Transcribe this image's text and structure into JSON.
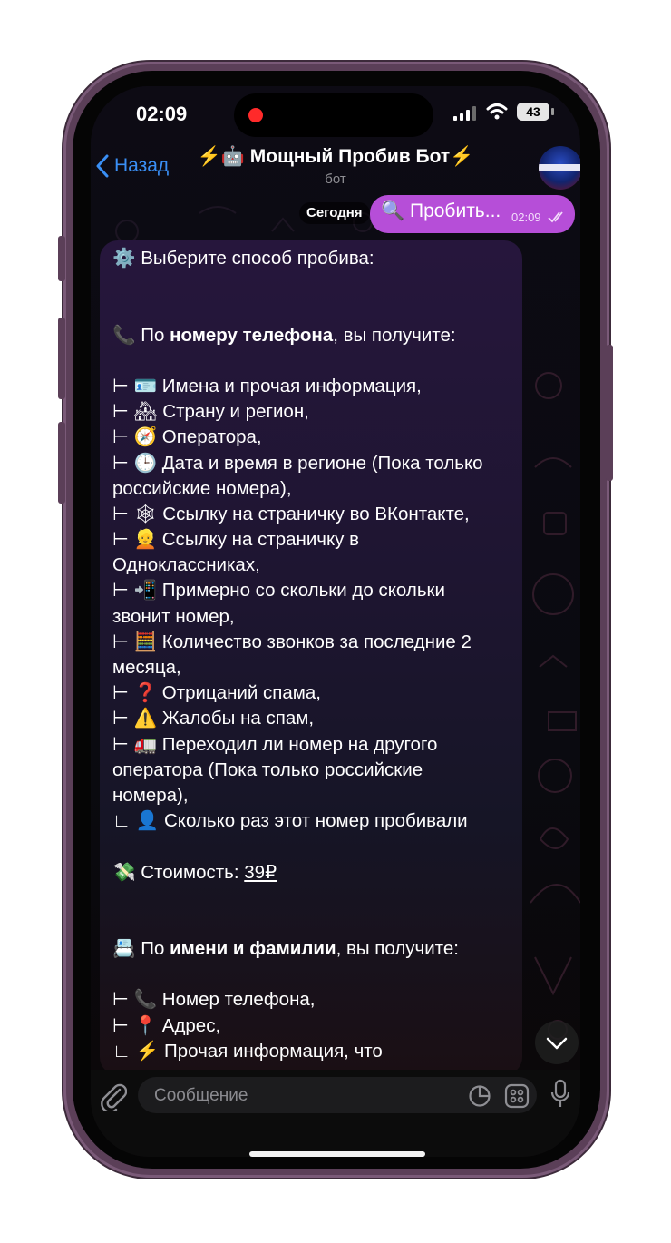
{
  "status_bar": {
    "time": "02:09",
    "battery": "43",
    "icons": [
      "recording-dot-icon",
      "signal-icon",
      "wifi-icon",
      "battery-icon"
    ]
  },
  "header": {
    "back_label": "Назад",
    "title": "⚡️🤖 Мощный Пробив Бот⚡️",
    "subtitle": "бот"
  },
  "date_label": "Сегодня",
  "outgoing": {
    "text": "🔍 Пробить...",
    "time": "02:09"
  },
  "incoming": {
    "l01": "⚙️ Выберите способ пробива:",
    "l02_icon": "📞",
    "l02_a": "По ",
    "l02_b": "номеру телефона",
    "l02_c": ", вы получите:",
    "l03": "⊢ 🪪 Имена и прочая информация,",
    "l04": "⊢ 🏘 Страну и регион,",
    "l05": "⊢ 🧭 Оператора,",
    "l06": "⊢ 🕒 Дата и время в регионе (Пока только",
    "l07": "российские номера),",
    "l08": "⊢ 🕸 Ссылку на страничку во ВКонтакте,",
    "l09": "⊢ 👱 Ссылку на страничку в",
    "l10": "Одноклассниках,",
    "l11": "⊢ 📲 Примерно со скольки до скольки",
    "l12": "звонит номер,",
    "l13": "⊢ 🧮 Количество звонков за последние 2",
    "l14": "месяца,",
    "l15": "⊢ ❓ Отрицаний спама,",
    "l16": "⊢ ⚠️ Жалобы на спам,",
    "l17": "⊢ 🚛 Переходил ли номер на другого",
    "l18": "оператора (Пока только российские",
    "l19": "номера),",
    "l20": "∟ 👤 Сколько раз этот номер пробивали",
    "price_icon": "💸",
    "price_label": "Стоимость: ",
    "price_value": "39₽",
    "l22_icon": "📇",
    "l22_a": "По ",
    "l22_b": "имени и фамилии",
    "l22_c": ", вы получите:",
    "l23": "⊢ 📞 Номер телефона,",
    "l24": "⊢ 📍 Адрес,",
    "l25": "∟ ⚡️ Прочая информация, что"
  },
  "input": {
    "placeholder": "Сообщение"
  },
  "colors": {
    "accent": "#3a8ff5",
    "outgoing_bubble": "#b64ed8",
    "frame": "#5b3f58"
  }
}
